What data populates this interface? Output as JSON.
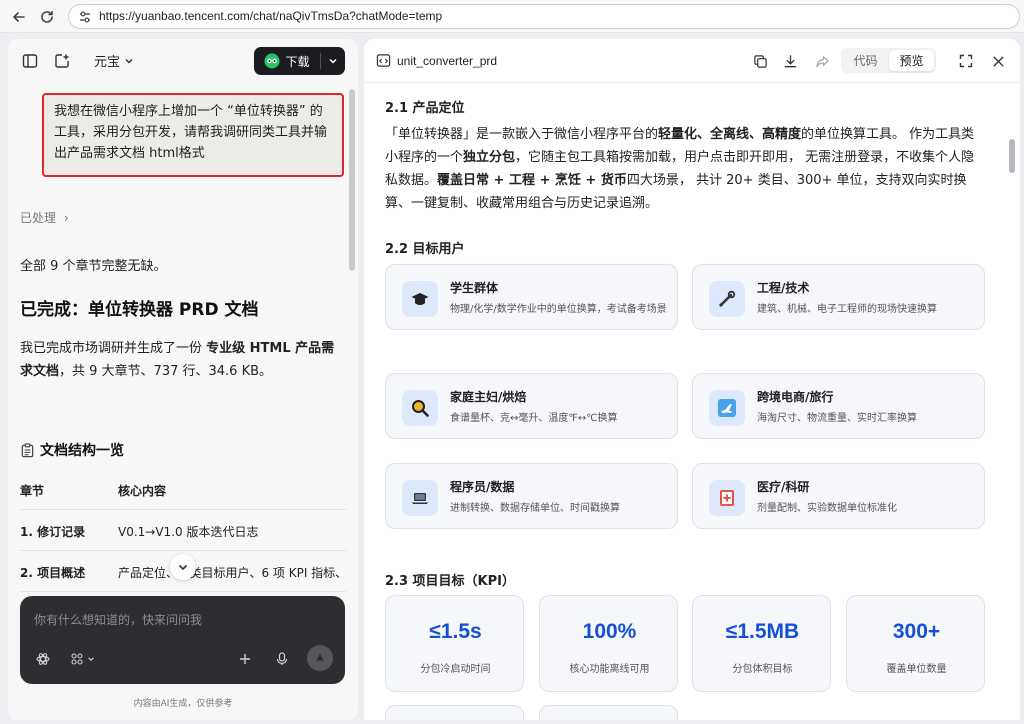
{
  "browser": {
    "url": "https://yuanbao.tencent.com/chat/naQivTmsDa?chatMode=temp"
  },
  "left": {
    "brand": "元宝",
    "download_label": "下载",
    "user_message": "我想在微信小程序上增加一个 “单位转换器” 的工具，采用分包开发，请帮我调研同类工具并输出产品需求文档 html格式",
    "processed_label": "已处理",
    "summary_line": "全部 9 个章节完整无缺。",
    "done_heading": "已完成：单位转换器 PRD 文档",
    "report_pre": "我已完成市场调研并生成了一份 ",
    "report_bold": "专业级 HTML 产品需求文档",
    "report_post": "，共 9 大章节、737 行、34.6 KB。",
    "structure_heading": "文档结构一览",
    "table": {
      "headers": [
        "章节",
        "核心内容"
      ],
      "rows": [
        [
          "1. 修订记录",
          "V0.1→V1.0 版本迭代日志"
        ],
        [
          "2. 项目概述",
          "产品定位、5 类目标用户、6 项 KPI 指标、"
        ]
      ]
    },
    "composer_placeholder": "你有什么想知道的，快来问问我",
    "footnote": "内容由AI生成，仅供参考"
  },
  "right": {
    "doc_title": "unit_converter_prd",
    "tab_code": "代码",
    "tab_preview": "预览",
    "sec_positioning": "2.1 产品定位",
    "pos_p1": "「单位转换器」是一款嵌入于微信小程序平台的",
    "pos_b1": "轻量化、全离线、高精度",
    "pos_p2": "的单位换算工具。 作为工具类小程序的一个",
    "pos_b2": "独立分包",
    "pos_p3": "，它随主包工具箱按需加载，用户点击即开即用， 无需注册登录，不收集个人隐私数据。",
    "pos_b3": "覆盖日常 + 工程 + 烹饪 + 货币",
    "pos_p4": "四大场景， 共计 20+ 类目、300+ 单位，支持双向实时换算、一键复制、收藏常用组合与历史记录追溯。",
    "sec_users": "2.2 目标用户",
    "users": [
      {
        "title": "学生群体",
        "desc": "物理/化学/数学作业中的单位换算，考试备考场景",
        "icon": "graduation-cap-icon"
      },
      {
        "title": "工程/技术",
        "desc": "建筑、机械、电子工程师的现场快速换算",
        "icon": "wrench-icon"
      },
      {
        "title": "家庭主妇/烘焙",
        "desc": "食谱量杯、克↔毫升、温度℉↔℃换算",
        "icon": "magnifier-icon"
      },
      {
        "title": "跨境电商/旅行",
        "desc": "海淘尺寸、物流重量、实时汇率换算",
        "icon": "airplane-icon"
      },
      {
        "title": "程序员/数据",
        "desc": "进制转换、数据存储单位、时间戳换算",
        "icon": "laptop-icon"
      },
      {
        "title": "医疗/科研",
        "desc": "剂量配制、实验数据单位标准化",
        "icon": "medical-icon"
      }
    ],
    "sec_kpi": "2.3 项目目标（KPI）",
    "kpis": [
      {
        "value": "≤1.5s",
        "label": "分包冷启动时间"
      },
      {
        "value": "100%",
        "label": "核心功能离线可用"
      },
      {
        "value": "≤1.5MB",
        "label": "分包体积目标"
      },
      {
        "value": "300+",
        "label": "覆盖单位数量"
      }
    ],
    "accent": "#1450d6"
  }
}
